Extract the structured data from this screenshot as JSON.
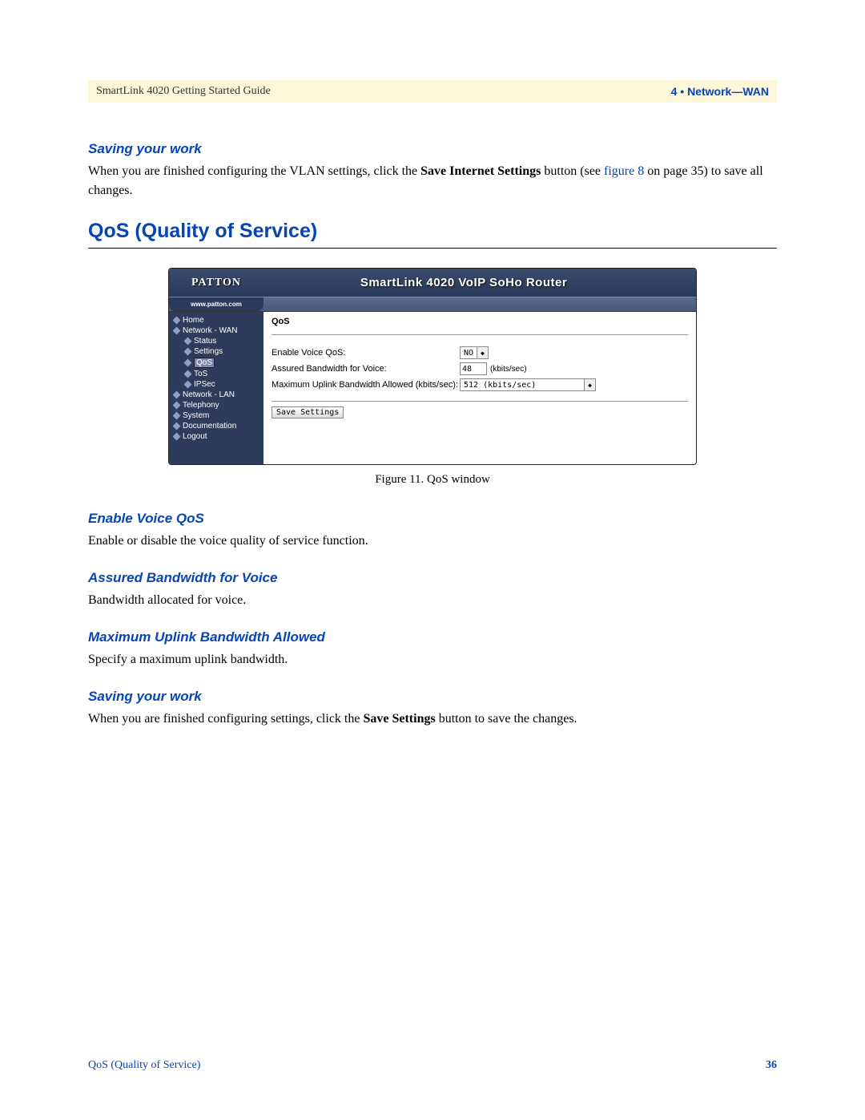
{
  "header": {
    "left": "SmartLink 4020 Getting Started Guide",
    "right": "4 • Network—WAN"
  },
  "sections": {
    "saving1": {
      "title": "Saving your work",
      "body_prefix": "When you are finished configuring the VLAN settings, click the ",
      "body_bold": "Save Internet Settings",
      "body_mid": " button (see ",
      "body_link": "figure 8",
      "body_suffix": " on page 35) to save all changes."
    },
    "main_heading": "QoS (Quality of Service)",
    "enable": {
      "title": "Enable Voice QoS",
      "body": "Enable or disable the voice quality of service function."
    },
    "assured": {
      "title": "Assured Bandwidth for Voice",
      "body": "Bandwidth allocated for voice."
    },
    "max": {
      "title": "Maximum Uplink Bandwidth Allowed",
      "body": "Specify a maximum uplink bandwidth."
    },
    "saving2": {
      "title": "Saving your work",
      "body_prefix": "When you are finished configuring settings, click the ",
      "body_bold": "Save Settings",
      "body_suffix": " button to save the changes."
    }
  },
  "figure": {
    "caption": "Figure 11. QoS window",
    "banner_brand": "PATTON",
    "banner_title": "SmartLink 4020 VoIP SoHo Router",
    "brand_link": "www.patton.com",
    "nav": [
      {
        "label": "Home",
        "sub": false,
        "active": false
      },
      {
        "label": "Network - WAN",
        "sub": false,
        "active": false
      },
      {
        "label": "Status",
        "sub": true,
        "active": false
      },
      {
        "label": "Settings",
        "sub": true,
        "active": false
      },
      {
        "label": "QoS",
        "sub": true,
        "active": true
      },
      {
        "label": "ToS",
        "sub": true,
        "active": false
      },
      {
        "label": "IPSec",
        "sub": true,
        "active": false
      },
      {
        "label": "Network - LAN",
        "sub": false,
        "active": false
      },
      {
        "label": "Telephony",
        "sub": false,
        "active": false
      },
      {
        "label": "System",
        "sub": false,
        "active": false
      },
      {
        "label": "Documentation",
        "sub": false,
        "active": false
      },
      {
        "label": "Logout",
        "sub": false,
        "active": false
      }
    ],
    "content_title": "QoS",
    "form": {
      "enable_label": "Enable Voice QoS:",
      "enable_value": "NO",
      "assured_label": "Assured Bandwidth for Voice:",
      "assured_value": "48",
      "assured_unit": "(kbits/sec)",
      "max_label": "Maximum Uplink Bandwidth Allowed (kbits/sec):",
      "max_value": "512 (kbits/sec)",
      "button": "Save Settings"
    }
  },
  "footer": {
    "left": "QoS (Quality of Service)",
    "right": "36"
  }
}
